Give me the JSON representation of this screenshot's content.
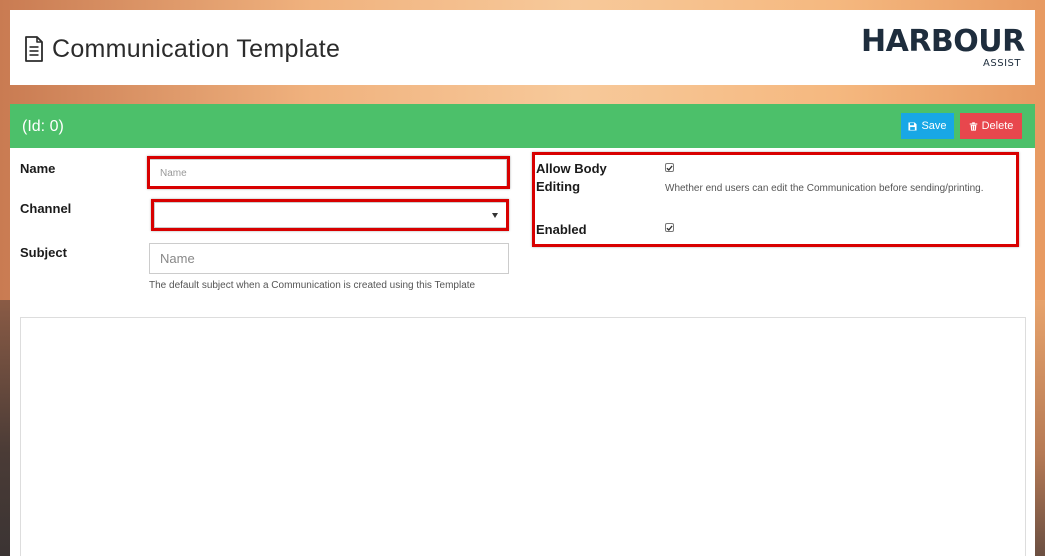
{
  "header": {
    "title": "Communication Template",
    "logo": {
      "main": "HARBOUR",
      "sub": "ASSIST"
    }
  },
  "toolbar": {
    "id_label": "(Id: 0)",
    "save_label": "Save",
    "delete_label": "Delete"
  },
  "form": {
    "name": {
      "label": "Name",
      "placeholder": "Name",
      "value": ""
    },
    "channel": {
      "label": "Channel",
      "value": ""
    },
    "subject": {
      "label": "Subject",
      "placeholder": "Name",
      "help": "The default subject when a Communication is created using this Template"
    },
    "allow_body_editing": {
      "label_line1": "Allow Body",
      "label_line2": "Editing",
      "checked": true,
      "help": "Whether end users can edit the Communication before sending/printing."
    },
    "enabled": {
      "label": "Enabled",
      "checked": true
    }
  },
  "colors": {
    "green_bar": "#4cc06a",
    "save_button": "#18a7e6",
    "delete_button": "#e8474d",
    "highlight": "#d80000"
  },
  "icons": [
    "document-icon",
    "floppy-disk-icon",
    "trash-icon",
    "checkmark-icon",
    "chevron-down-icon"
  ]
}
